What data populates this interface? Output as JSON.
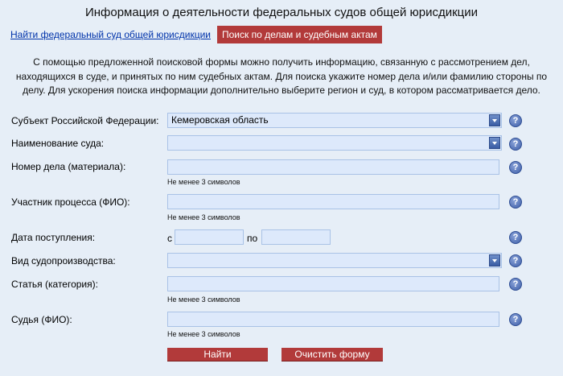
{
  "header": {
    "title": "Информация о деятельности федеральных судов общей юрисдикции"
  },
  "tabs": {
    "find_court": "Найти федеральный суд общей юрисдикции",
    "search_cases": "Поиск по делам и судебным актам"
  },
  "intro": {
    "line1": "С помощью предложенной поисковой формы можно получить информацию, связанную с рассмотрением дел,",
    "line2": "находящихся в суде, и принятых по ним судебных актам. Для поиска укажите номер дела и/или фамилию стороны по",
    "line3": "делу. Для ускорения поиска информации дополнительно выберите регион и суд, в котором рассматривается дело."
  },
  "form": {
    "region_label": "Субъект Российской Федерации:",
    "region_value": "Кемеровская область",
    "court_label": "Наименование суда:",
    "court_value": "",
    "case_number_label": "Номер дела (материала):",
    "case_number_hint": "Не менее 3 символов",
    "participant_label": "Участник процесса (ФИО):",
    "participant_hint": "Не менее 3 символов",
    "date_label": "Дата поступления:",
    "date_from_prefix": "с",
    "date_to_prefix": "по",
    "proceeding_label": "Вид судопроизводства:",
    "proceeding_value": "",
    "article_label": "Статья (категория):",
    "article_hint": "Не менее 3 символов",
    "judge_label": "Судья (ФИО):",
    "judge_hint": "Не менее 3 символов",
    "help_glyph": "?"
  },
  "buttons": {
    "search": "Найти",
    "clear": "Очистить форму"
  },
  "colors": {
    "page_bg": "#e6eef7",
    "field_bg": "#dde9fb",
    "accent_red": "#b23a3a",
    "link_blue": "#0033aa"
  }
}
